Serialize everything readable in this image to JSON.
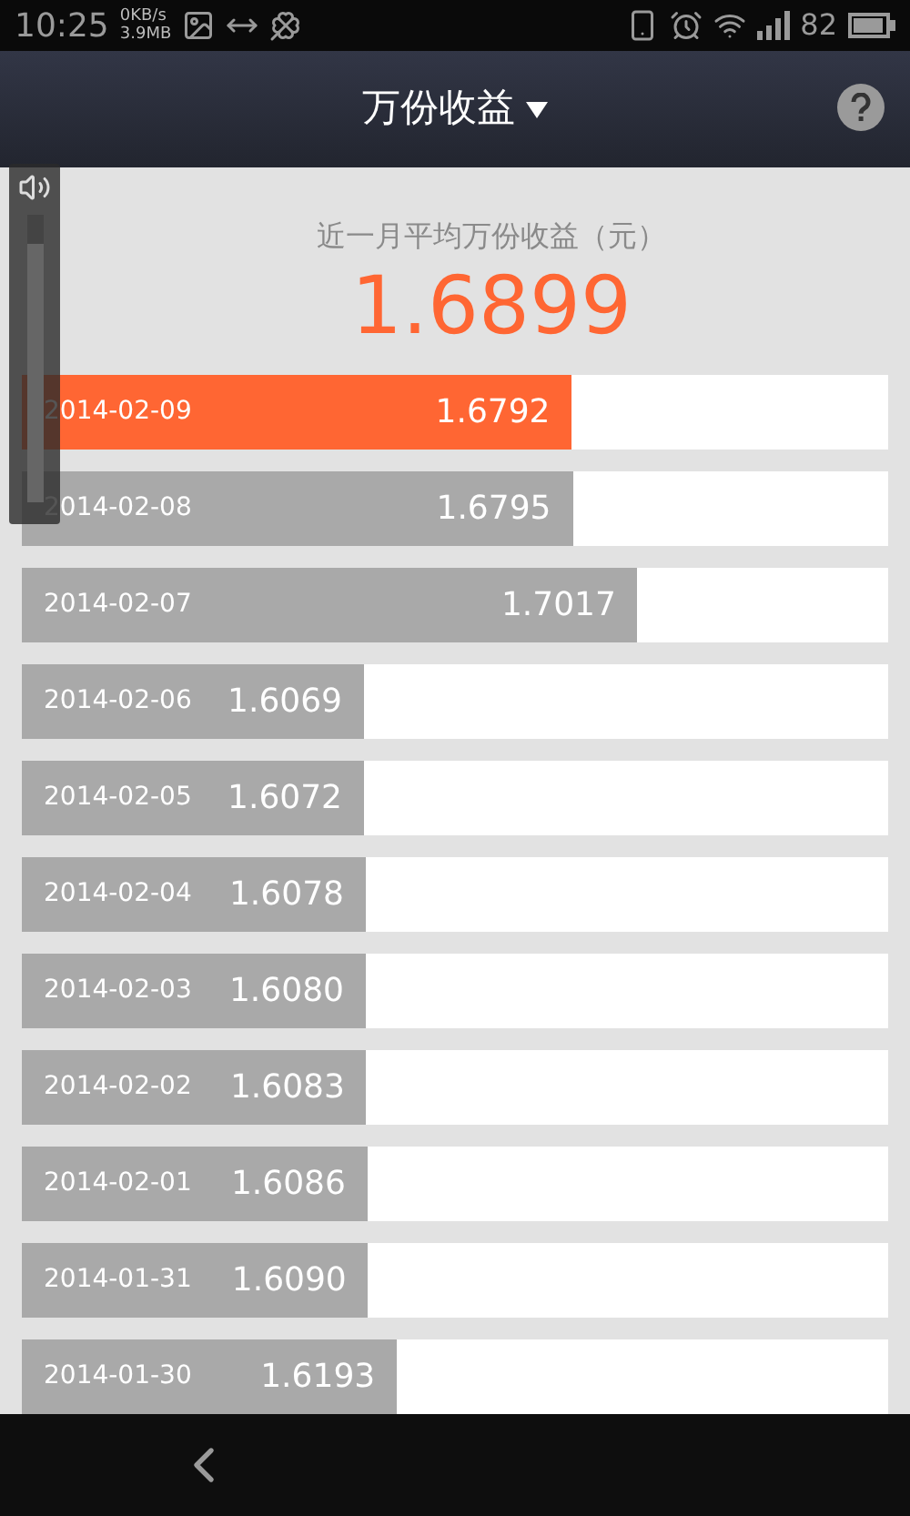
{
  "status_bar": {
    "time": "10:25",
    "net_speed": "0KB/s",
    "data_used": "3.9MB",
    "battery": "82"
  },
  "header": {
    "title": "万份收益"
  },
  "summary": {
    "label": "近一月平均万份收益（元）",
    "value": "1.6899"
  },
  "volume": {
    "level": 0.9
  },
  "rows": [
    {
      "date": "2014-02-09",
      "value": "1.6792",
      "level": 0.635,
      "selected": true
    },
    {
      "date": "2014-02-08",
      "value": "1.6795",
      "level": 0.636,
      "selected": false
    },
    {
      "date": "2014-02-07",
      "value": "1.7017",
      "level": 0.711,
      "selected": false
    },
    {
      "date": "2014-02-06",
      "value": "1.6069",
      "level": 0.395,
      "selected": false
    },
    {
      "date": "2014-02-05",
      "value": "1.6072",
      "level": 0.395,
      "selected": false
    },
    {
      "date": "2014-02-04",
      "value": "1.6078",
      "level": 0.397,
      "selected": false
    },
    {
      "date": "2014-02-03",
      "value": "1.6080",
      "level": 0.397,
      "selected": false
    },
    {
      "date": "2014-02-02",
      "value": "1.6083",
      "level": 0.398,
      "selected": false
    },
    {
      "date": "2014-02-01",
      "value": "1.6086",
      "level": 0.399,
      "selected": false
    },
    {
      "date": "2014-01-31",
      "value": "1.6090",
      "level": 0.4,
      "selected": false
    },
    {
      "date": "2014-01-30",
      "value": "1.6193",
      "level": 0.433,
      "selected": false
    }
  ]
}
